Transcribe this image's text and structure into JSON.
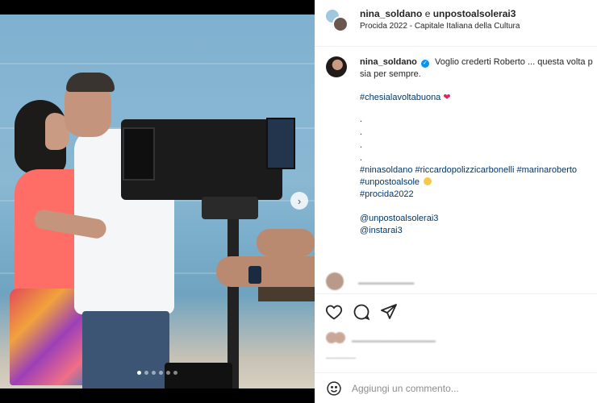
{
  "post": {
    "header": {
      "user_primary": "nina_soldano",
      "connector": "e",
      "user_secondary": "unpostoalsolerai3",
      "location": "Procida 2022 - Capitale Italiana della Cultura"
    },
    "caption": {
      "username": "nina_soldano",
      "verified_icon": "verified-badge-icon",
      "text_line1": "Voglio crederti Roberto ... questa volta p",
      "text_line2": "sia per sempre.",
      "hashtag_main": "#chesialavoltabuona",
      "heart_emoji": "❤",
      "dots": [
        ".",
        ".",
        ".",
        "."
      ],
      "tags_line1": "#ninasoldano #riccardopolizzicarbonelli #marinaroberto",
      "tags_line2": "#unpostoalsole",
      "tags_line3": "#procida2022",
      "mention1": "@unpostoalsolerai3",
      "mention2": "@instarai3"
    },
    "carousel": {
      "next_icon": "chevron-right-icon",
      "next_glyph": "›",
      "total_slides": 6,
      "active_slide": 1
    },
    "actions": {
      "like_icon": "heart-icon",
      "comment_icon": "comment-bubble-icon",
      "share_icon": "paper-plane-icon"
    },
    "add_comment": {
      "emoji_icon": "smiley-icon",
      "placeholder": "Aggiungi un commento..."
    },
    "colors": {
      "link": "#00376b",
      "verified": "#0095f6",
      "muted": "#8e8e8e",
      "border": "#efefef"
    }
  }
}
